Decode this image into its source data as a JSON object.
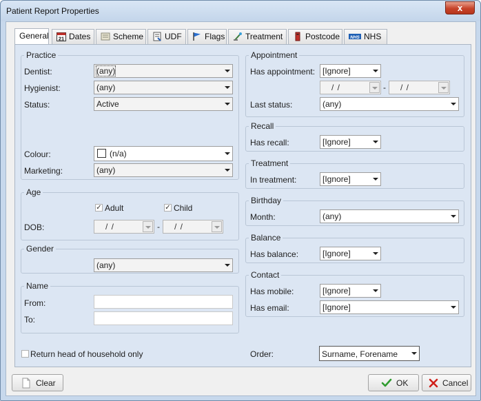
{
  "window": {
    "title": "Patient Report Properties",
    "close_label": "x"
  },
  "tabs": [
    {
      "label": "General",
      "icon": "none"
    },
    {
      "label": "Dates",
      "icon": "calendar-icon"
    },
    {
      "label": "Scheme",
      "icon": "scheme-icon"
    },
    {
      "label": "UDF",
      "icon": "udf-icon"
    },
    {
      "label": "Flags",
      "icon": "flag-icon"
    },
    {
      "label": "Treatment",
      "icon": "treatment-icon"
    },
    {
      "label": "Postcode",
      "icon": "postcode-icon"
    },
    {
      "label": "NHS",
      "icon": "nhs-icon"
    }
  ],
  "calendar_day": "21",
  "nhs_badge": "NHS",
  "practice": {
    "legend": "Practice",
    "dentist_label": "Dentist:",
    "dentist_value": "(any)",
    "hygienist_label": "Hygienist:",
    "hygienist_value": "(any)",
    "status_label": "Status:",
    "status_value": "Active",
    "colour_label": "Colour:",
    "colour_value": "(n/a)",
    "marketing_label": "Marketing:",
    "marketing_value": "(any)"
  },
  "age": {
    "legend": "Age",
    "adult_label": "Adult",
    "adult_checked": true,
    "child_label": "Child",
    "child_checked": true,
    "dob_label": "DOB:",
    "dob_from": "/ /",
    "dob_sep": "-",
    "dob_to": "/ /"
  },
  "gender": {
    "legend": "Gender",
    "value": "(any)"
  },
  "name": {
    "legend": "Name",
    "from_label": "From:",
    "from_value": "",
    "to_label": "To:",
    "to_value": ""
  },
  "household": {
    "label": "Return head of household only",
    "checked": false
  },
  "appointment": {
    "legend": "Appointment",
    "has_label": "Has appointment:",
    "has_value": "[Ignore]",
    "date_from": "/ /",
    "date_sep": "-",
    "date_to": "/ /",
    "last_status_label": "Last status:",
    "last_status_value": "(any)"
  },
  "recall": {
    "legend": "Recall",
    "has_label": "Has recall:",
    "has_value": "[Ignore]"
  },
  "treatment": {
    "legend": "Treatment",
    "in_label": "In treatment:",
    "in_value": "[Ignore]"
  },
  "birthday": {
    "legend": "Birthday",
    "month_label": "Month:",
    "month_value": "(any)"
  },
  "balance": {
    "legend": "Balance",
    "has_label": "Has balance:",
    "has_value": "[Ignore]"
  },
  "contact": {
    "legend": "Contact",
    "mobile_label": "Has mobile:",
    "mobile_value": "[Ignore]",
    "email_label": "Has email:",
    "email_value": "[Ignore]"
  },
  "order": {
    "label": "Order:",
    "value": "Surname, Forename"
  },
  "buttons": {
    "clear": "Clear",
    "ok": "OK",
    "cancel": "Cancel"
  },
  "colors": {
    "ok_green": "#2e9b2e",
    "cancel_red": "#d0201a",
    "panel_bg": "#dce6f3",
    "window_frame": "#c7d8ec"
  }
}
